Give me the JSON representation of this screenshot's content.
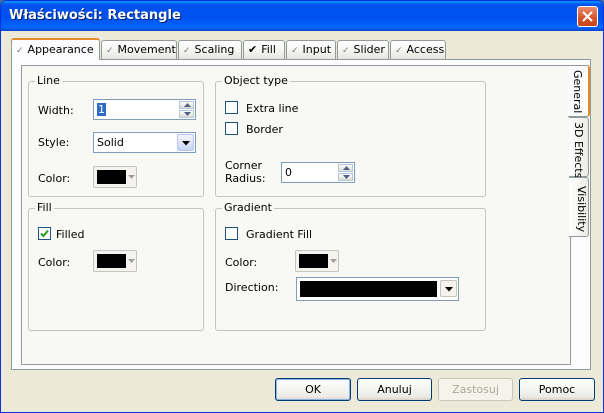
{
  "window": {
    "title": "Właściwości: Rectangle"
  },
  "tabs": [
    {
      "label": "Appearance",
      "checked": false
    },
    {
      "label": "Movement",
      "checked": false
    },
    {
      "label": "Scaling",
      "checked": false
    },
    {
      "label": "Fill",
      "checked": true
    },
    {
      "label": "Input",
      "checked": false
    },
    {
      "label": "Slider",
      "checked": false
    },
    {
      "label": "Access",
      "checked": false
    }
  ],
  "side_tabs": [
    {
      "label": "General"
    },
    {
      "label": "3D Effects"
    },
    {
      "label": "Visibility"
    }
  ],
  "line_group": {
    "title": "Line",
    "width_label": "Width:",
    "width_value": "1",
    "style_label": "Style:",
    "style_value": "Solid",
    "color_label": "Color:",
    "color": "#000000"
  },
  "object_type_group": {
    "title": "Object type",
    "extra_line_label": "Extra line",
    "extra_line_checked": false,
    "border_label": "Border",
    "border_checked": false,
    "corner_label_1": "Corner",
    "corner_label_2": "Radius:",
    "corner_value": "0"
  },
  "fill_group": {
    "title": "Fill",
    "filled_label": "Filled",
    "filled_checked": true,
    "color_label": "Color:",
    "color": "#000000"
  },
  "gradient_group": {
    "title": "Gradient",
    "gradient_fill_label": "Gradient Fill",
    "gradient_fill_checked": false,
    "color_label": "Color:",
    "color": "#000000",
    "direction_label": "Direction:"
  },
  "buttons": {
    "ok": "OK",
    "cancel": "Anuluj",
    "apply": "Zastosuj",
    "help": "Pomoc"
  }
}
